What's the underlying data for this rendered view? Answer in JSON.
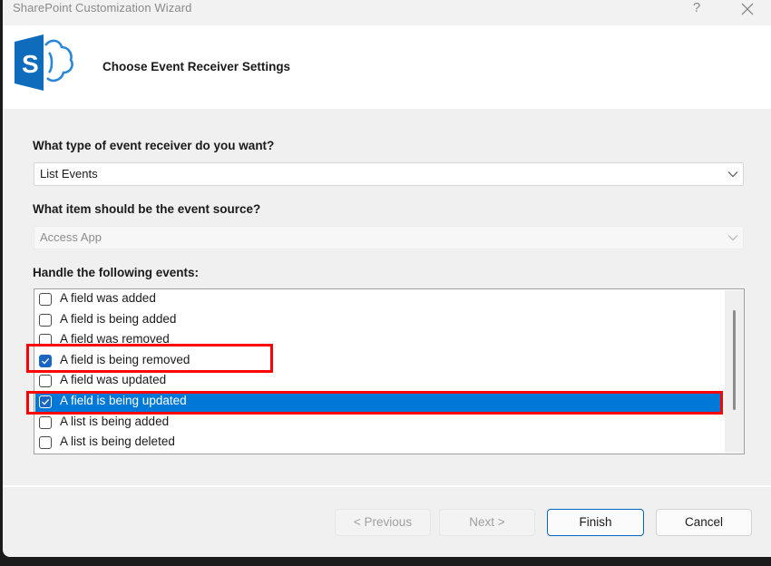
{
  "window": {
    "title": "SharePoint Customization Wizard",
    "help_label": "?",
    "close_icon": "close-icon"
  },
  "header": {
    "logo_icon": "sharepoint-logo-icon",
    "title": "Choose Event Receiver Settings"
  },
  "event_type": {
    "label": "What type of event receiver do you want?",
    "selected": "List Events",
    "enabled": true
  },
  "event_source": {
    "label": "What item should be the event source?",
    "selected": "Access App",
    "enabled": false
  },
  "events": {
    "label": "Handle the following events:",
    "items": [
      {
        "label": "A field was added",
        "checked": false,
        "selected": false
      },
      {
        "label": "A field is being added",
        "checked": false,
        "selected": false
      },
      {
        "label": "A field was removed",
        "checked": false,
        "selected": false
      },
      {
        "label": "A field is being removed",
        "checked": true,
        "selected": false,
        "highlighted": true
      },
      {
        "label": "A field was updated",
        "checked": false,
        "selected": false
      },
      {
        "label": "A field is being updated",
        "checked": true,
        "selected": true,
        "highlighted": true
      },
      {
        "label": "A list is being added",
        "checked": false,
        "selected": false
      },
      {
        "label": "A list is being deleted",
        "checked": false,
        "selected": false
      }
    ]
  },
  "buttons": {
    "previous": {
      "label": "< Previous",
      "enabled": false
    },
    "next": {
      "label": "Next >",
      "enabled": false
    },
    "finish": {
      "label": "Finish",
      "enabled": true,
      "default": true
    },
    "cancel": {
      "label": "Cancel",
      "enabled": true
    }
  },
  "colors": {
    "accent": "#0078d7",
    "checkbox_checked": "#1a66c2",
    "annotation": "#ff0000",
    "logo_blue": "#0f6cbd"
  }
}
